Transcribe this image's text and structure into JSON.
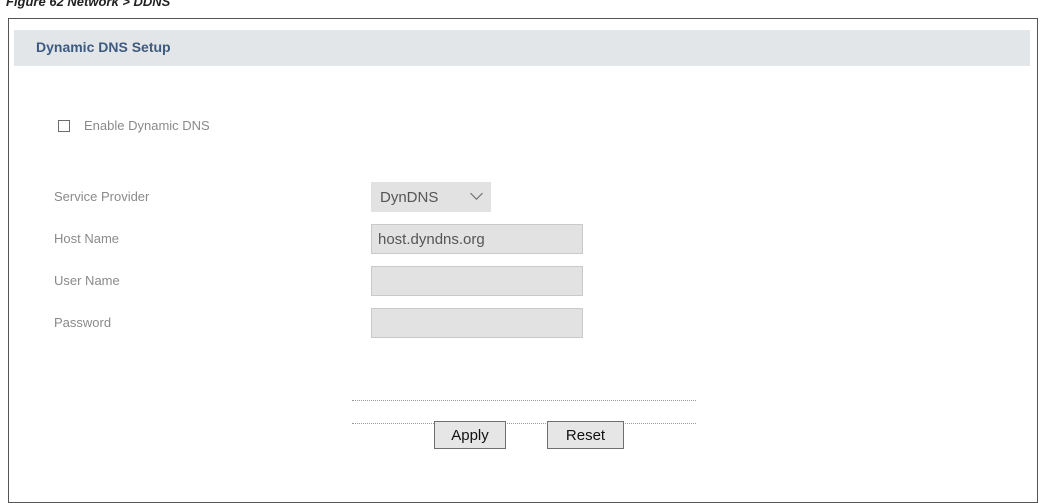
{
  "figure": {
    "caption": "Figure 62   Network > DDNS"
  },
  "section": {
    "title": "Dynamic DNS Setup"
  },
  "enable": {
    "label": "Enable Dynamic DNS",
    "checked": false
  },
  "fields": {
    "service_provider": {
      "label": "Service Provider",
      "value": "DynDNS"
    },
    "host_name": {
      "label": "Host Name",
      "value": "host.dyndns.org"
    },
    "user_name": {
      "label": "User Name",
      "value": ""
    },
    "password": {
      "label": "Password",
      "value": ""
    }
  },
  "buttons": {
    "apply": "Apply",
    "reset": "Reset"
  },
  "colors": {
    "header_bg": "#e3e6e8",
    "title": "#3d5a80",
    "label": "#8a8a8a",
    "field_bg": "#e2e2e2"
  }
}
